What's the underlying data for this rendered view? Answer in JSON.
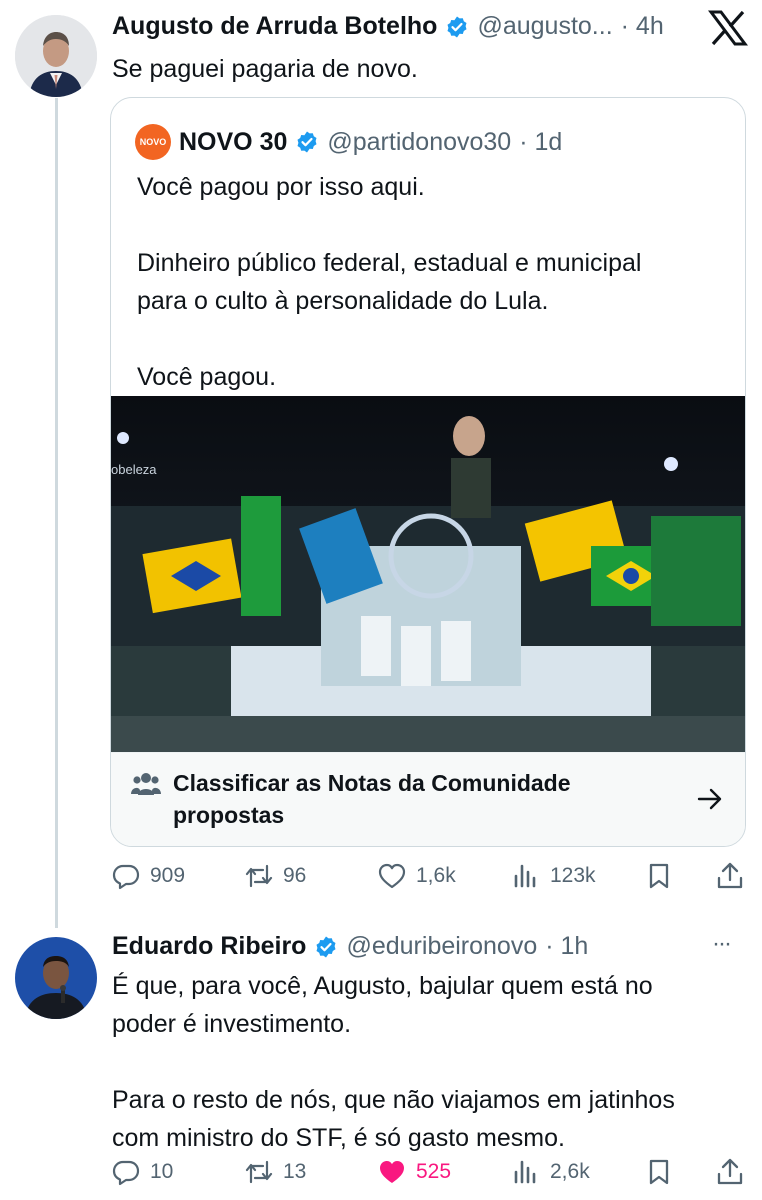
{
  "tweet1": {
    "author_name": "Augusto de Arruda Botelho",
    "handle": "@augusto...",
    "time": "· 4h",
    "text": "Se paguei pagaria de novo.",
    "x_logo": "X"
  },
  "quote": {
    "author_name": "NOVO 30",
    "handle": "@partidonovo30",
    "time": "· 1d",
    "logo_text": "NOVO",
    "text": "Você pagou por isso aqui.\n\nDinheiro público federal, estadual e municipal\npara o culto à personalidade do Lula.\n\nVocê pagou.",
    "image_watermark": "obeleza",
    "community_notes_label": "Classificar as Notas da Comunidade\npropostas"
  },
  "tweet1_actions": {
    "replies": "909",
    "retweets": "96",
    "likes": "1,6k",
    "views": "123k"
  },
  "tweet2": {
    "author_name": "Eduardo Ribeiro",
    "handle": "@eduribeironovo",
    "time": "· 1h",
    "more": "···",
    "text": "É que, para você, Augusto, bajular quem está no\npoder é investimento.\n\nPara o resto de nós, que não viajamos em jatinhos\ncom ministro do STF, é só gasto mesmo."
  },
  "tweet2_actions": {
    "replies": "10",
    "retweets": "13",
    "likes": "525",
    "views": "2,6k",
    "like_color": "#f91880"
  },
  "colors": {
    "verified": "#1d9bf0",
    "secondary_text": "#536471",
    "novo_orange": "#f26522"
  }
}
